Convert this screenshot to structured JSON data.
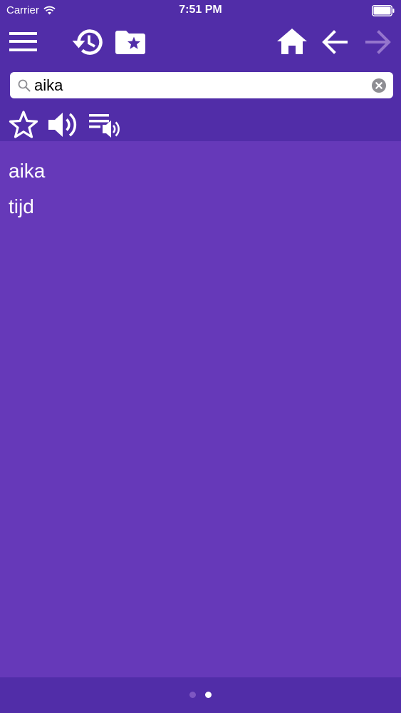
{
  "status_bar": {
    "carrier": "Carrier",
    "time": "7:51 PM"
  },
  "toolbar": {
    "icons": [
      "menu-icon",
      "history-icon",
      "favorites-folder-icon",
      "home-icon",
      "back-arrow-icon",
      "forward-arrow-icon"
    ]
  },
  "search": {
    "value": "aika",
    "placeholder": ""
  },
  "actions": {
    "icons": [
      "star-icon",
      "speaker-icon",
      "playlist-audio-icon"
    ]
  },
  "entry": {
    "headword": "aika",
    "translation": "tijd"
  },
  "pager": {
    "page_count": 2,
    "current_page": 2
  },
  "colors": {
    "header": "#512DA8",
    "content": "#6639B9",
    "icon": "#ffffff",
    "disabled_icon": "#9575CD",
    "inactive_dot": "#7E57C2"
  }
}
